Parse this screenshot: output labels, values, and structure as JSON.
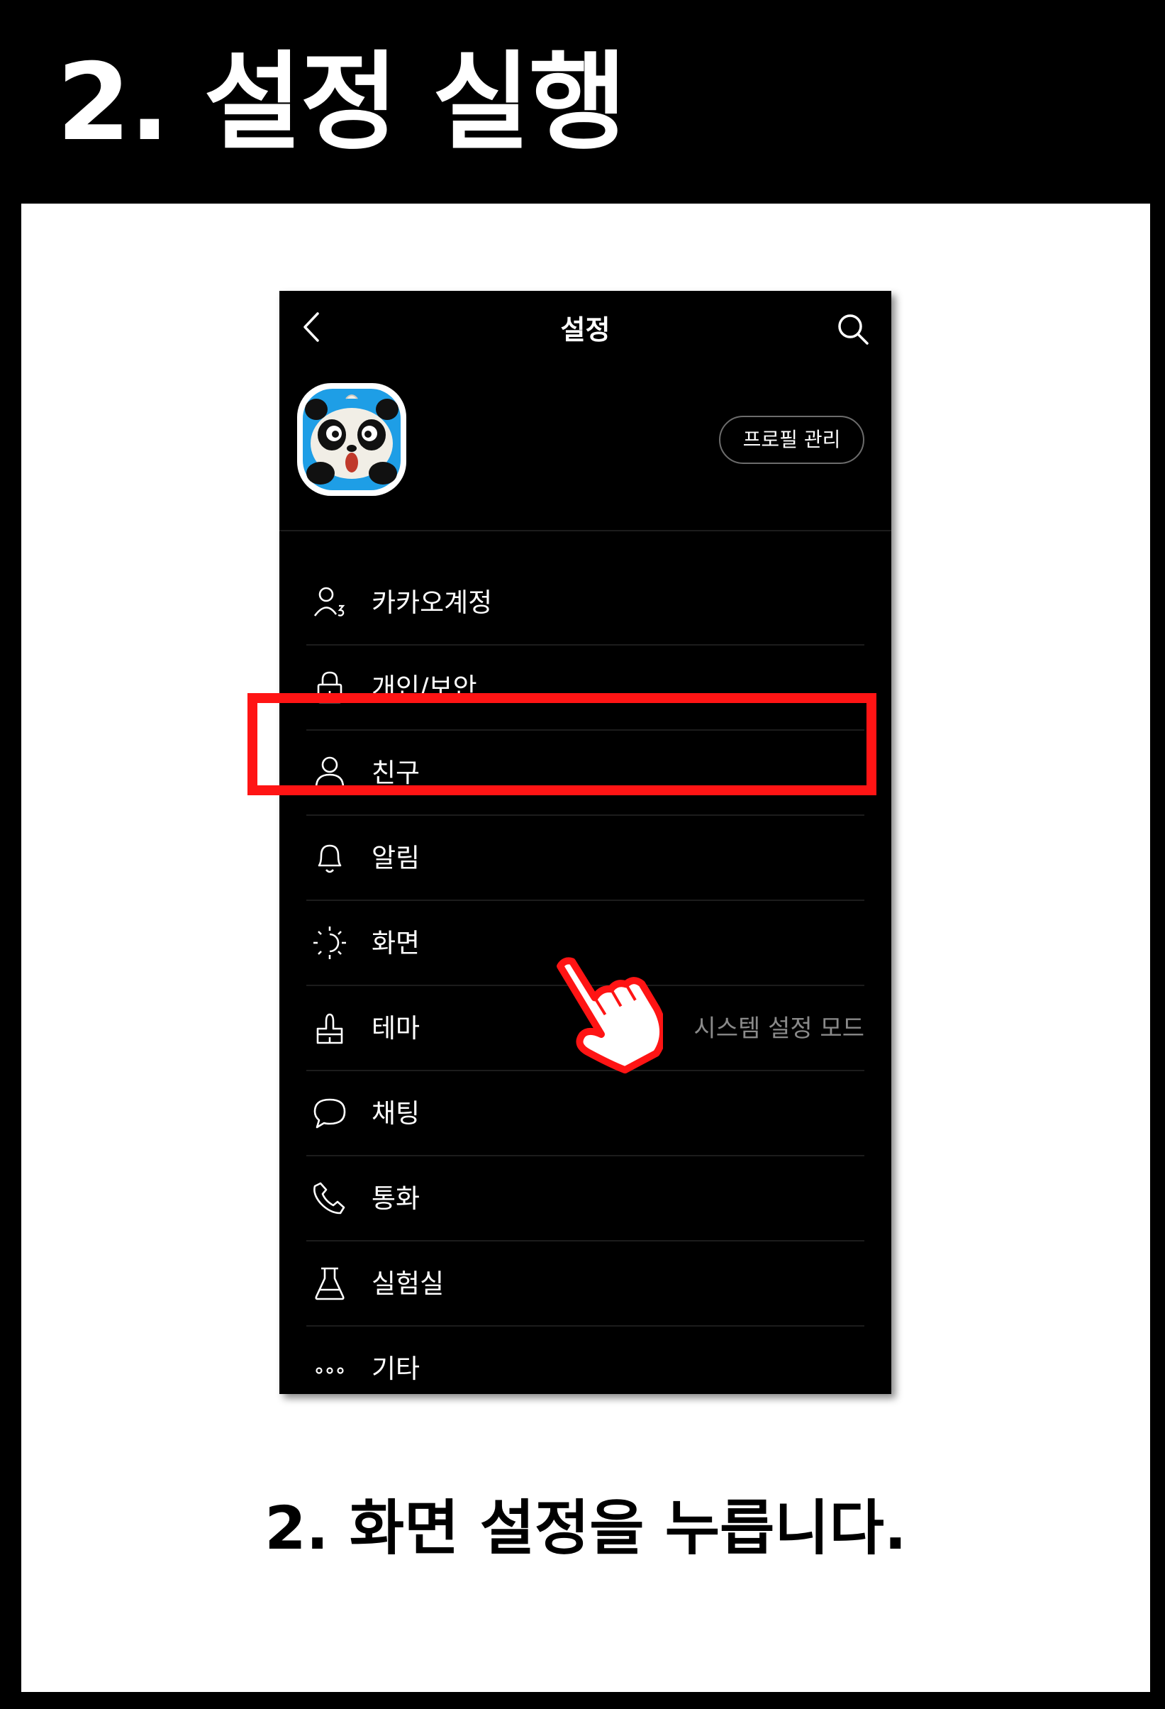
{
  "heading": "2. 설정 실행",
  "screen": {
    "title": "설정",
    "profile_button": "프로필 관리",
    "menu": [
      {
        "label": "카카오계정",
        "icon": "kakao-account-icon",
        "value": ""
      },
      {
        "label": "개인/보안",
        "icon": "lock-icon",
        "value": ""
      },
      {
        "label": "친구",
        "icon": "person-icon",
        "value": ""
      },
      {
        "label": "알림",
        "icon": "bell-icon",
        "value": ""
      },
      {
        "label": "화면",
        "icon": "display-icon",
        "value": ""
      },
      {
        "label": "테마",
        "icon": "theme-icon",
        "value": "시스템 설정 모드"
      },
      {
        "label": "채팅",
        "icon": "chat-bubble-icon",
        "value": ""
      },
      {
        "label": "통화",
        "icon": "phone-icon",
        "value": ""
      },
      {
        "label": "실험실",
        "icon": "flask-icon",
        "value": ""
      },
      {
        "label": "기타",
        "icon": "more-dots-icon",
        "value": ""
      }
    ]
  },
  "caption": "2. 화면 설정을 누릅니다.",
  "colors": {
    "highlight": "#ff1414",
    "background": "#000000",
    "panel": "#ffffff"
  }
}
